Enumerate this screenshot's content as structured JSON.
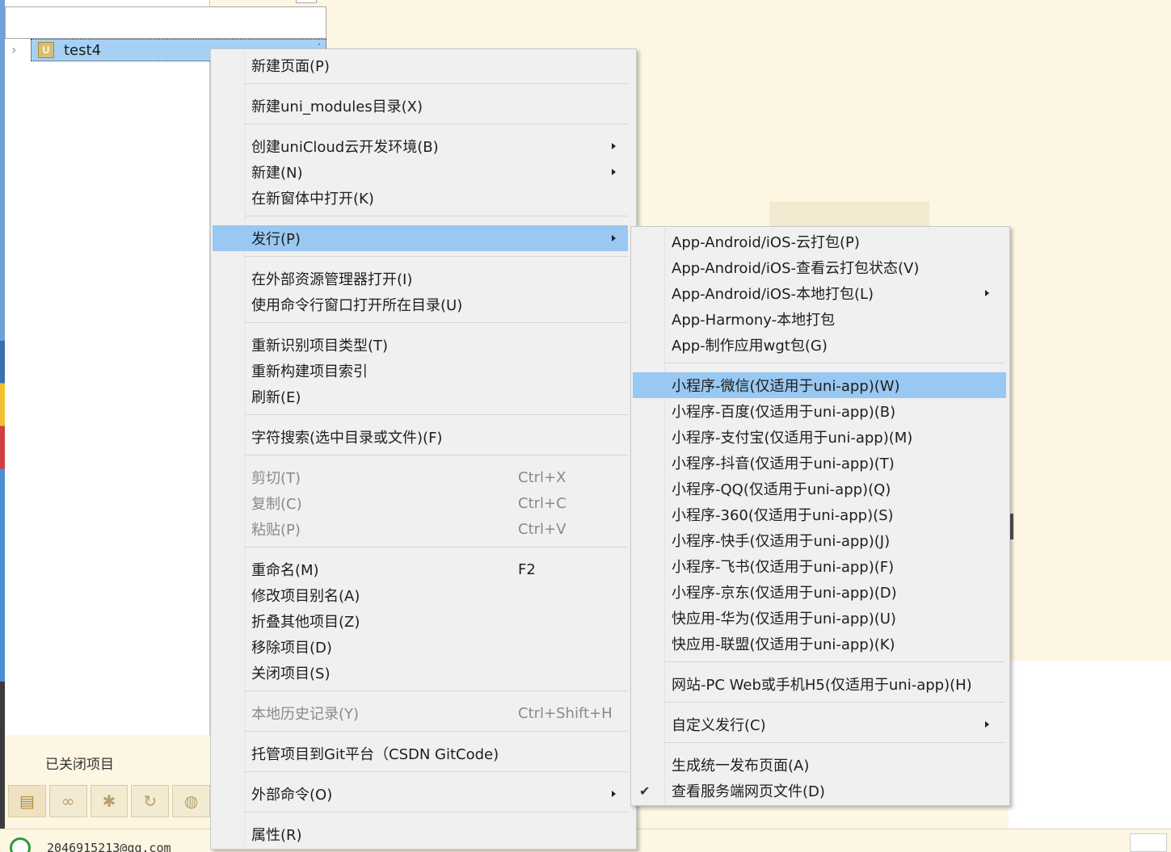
{
  "project_tree": {
    "project_icon": "uni-app-project-icon",
    "project_name": "test4"
  },
  "left_panel": {
    "closed_projects_label": "已关闭项目"
  },
  "bottom_icons": [
    "project-explorer-icon",
    "binoculars-icon",
    "bug-icon",
    "refresh-icon",
    "globe-icon"
  ],
  "status_bar": {
    "account": "2046915213@qq.com"
  },
  "context_menu": {
    "items": [
      {
        "label": "新建页面(P)"
      },
      {
        "label": "新建uni_modules目录(X)"
      },
      {
        "label": "创建uniCloud云开发环境(B)",
        "submenu": true
      },
      {
        "label": "新建(N)",
        "submenu": true
      },
      {
        "label": "在新窗体中打开(K)"
      },
      {
        "label": "发行(P)",
        "submenu": true,
        "highlighted": true
      },
      {
        "label": "在外部资源管理器打开(I)"
      },
      {
        "label": "使用命令行窗口打开所在目录(U)"
      },
      {
        "label": "重新识别项目类型(T)"
      },
      {
        "label": "重新构建项目索引"
      },
      {
        "label": "刷新(E)"
      },
      {
        "label": "字符搜索(选中目录或文件)(F)"
      },
      {
        "label": "剪切(T)",
        "shortcut": "Ctrl+X",
        "disabled": true
      },
      {
        "label": "复制(C)",
        "shortcut": "Ctrl+C",
        "disabled": true
      },
      {
        "label": "粘贴(P)",
        "shortcut": "Ctrl+V",
        "disabled": true
      },
      {
        "label": "重命名(M)",
        "shortcut": "F2"
      },
      {
        "label": "修改项目别名(A)"
      },
      {
        "label": "折叠其他项目(Z)"
      },
      {
        "label": "移除项目(D)"
      },
      {
        "label": "关闭项目(S)"
      },
      {
        "label": "本地历史记录(Y)",
        "shortcut": "Ctrl+Shift+H",
        "disabled": true
      },
      {
        "label": "托管项目到Git平台（CSDN GitCode)"
      },
      {
        "label": "外部命令(O)",
        "submenu": true
      },
      {
        "label": "属性(R)"
      }
    ]
  },
  "publish_submenu": {
    "items": [
      {
        "label": "App-Android/iOS-云打包(P)"
      },
      {
        "label": "App-Android/iOS-查看云打包状态(V)"
      },
      {
        "label": "App-Android/iOS-本地打包(L)",
        "submenu": true
      },
      {
        "label": "App-Harmony-本地打包"
      },
      {
        "label": "App-制作应用wgt包(G)"
      },
      {
        "label": "小程序-微信(仅适用于uni-app)(W)",
        "highlighted": true
      },
      {
        "label": "小程序-百度(仅适用于uni-app)(B)"
      },
      {
        "label": "小程序-支付宝(仅适用于uni-app)(M)"
      },
      {
        "label": "小程序-抖音(仅适用于uni-app)(T)"
      },
      {
        "label": "小程序-QQ(仅适用于uni-app)(Q)"
      },
      {
        "label": "小程序-360(仅适用于uni-app)(S)"
      },
      {
        "label": "小程序-快手(仅适用于uni-app)(J)"
      },
      {
        "label": "小程序-飞书(仅适用于uni-app)(F)"
      },
      {
        "label": "小程序-京东(仅适用于uni-app)(D)"
      },
      {
        "label": "快应用-华为(仅适用于uni-app)(U)"
      },
      {
        "label": "快应用-联盟(仅适用于uni-app)(K)"
      },
      {
        "label": "网站-PC Web或手机H5(仅适用于uni-app)(H)"
      },
      {
        "label": "自定义发行(C)",
        "submenu": true
      },
      {
        "label": "生成统一发布页面(A)"
      },
      {
        "label": "查看服务端网页文件(D)",
        "checked": true
      }
    ]
  }
}
